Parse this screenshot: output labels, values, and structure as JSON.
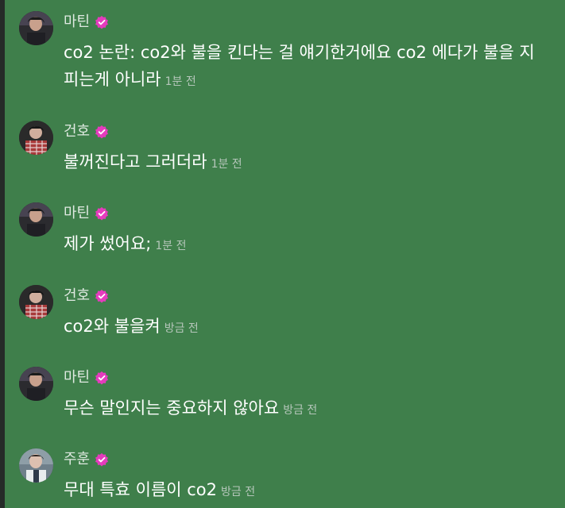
{
  "messages": [
    {
      "user": "마틴",
      "text": "co2 논란: co2와 불을 킨다는 걸 얘기한거에요 co2 에다가 불을 지피는게 아니라",
      "time": "1분 전"
    },
    {
      "user": "건호",
      "text": "불꺼진다고 그러더라",
      "time": "1분 전"
    },
    {
      "user": "마틴",
      "text": "제가 썼어요;",
      "time": "1분 전"
    },
    {
      "user": "건호",
      "text": "co2와 불을켜",
      "time": "방금 전"
    },
    {
      "user": "마틴",
      "text": "무슨 말인지는 중요하지 않아요",
      "time": "방금 전"
    },
    {
      "user": "주훈",
      "text": "무대 특효 이름이 co2",
      "time": "방금 전"
    }
  ],
  "colors": {
    "background": "#3f7f4b",
    "verified_badge": "#e53bbd",
    "time_text": "#b5c6ba"
  },
  "icons": {
    "verified": "verified-badge-icon"
  }
}
